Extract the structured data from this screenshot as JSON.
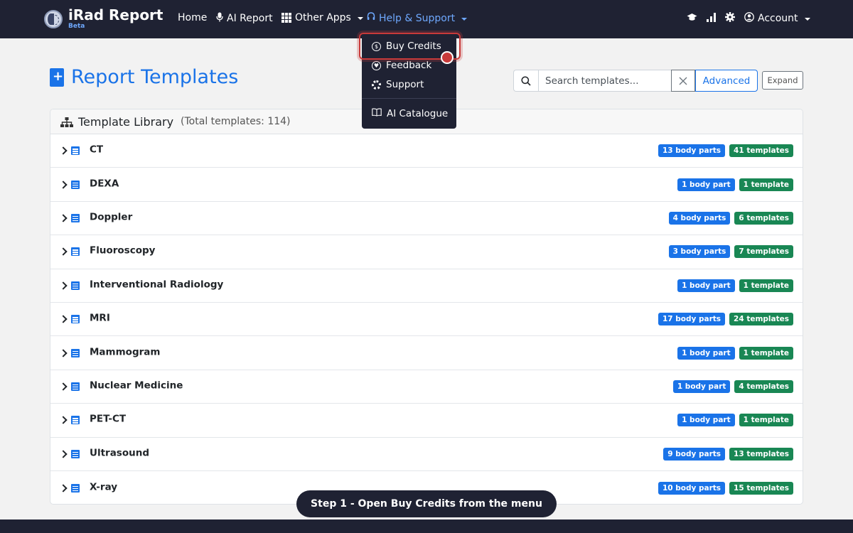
{
  "navbar": {
    "brand": "iRad Report",
    "brand_badge": "Beta",
    "items": [
      {
        "label": "Home",
        "icon": ""
      },
      {
        "label": "AI Report",
        "icon": "microphone-icon"
      },
      {
        "label": "Other Apps",
        "icon": "grid-icon"
      },
      {
        "label": "Help & Support",
        "icon": "headset-icon"
      }
    ],
    "right_icons": [
      "graduation-cap-icon",
      "signal-bars-icon",
      "gear-icon"
    ],
    "account_label": "Account"
  },
  "help_menu": {
    "items": [
      {
        "label": "Buy Credits",
        "icon": "dollar-circle-icon"
      },
      {
        "label": "Feedback",
        "icon": "chat-heart-icon"
      },
      {
        "label": "Support",
        "icon": "lifebuoy-icon"
      },
      {
        "label": "AI Catalogue",
        "icon": "book-icon"
      }
    ]
  },
  "page": {
    "title": "Report Templates",
    "search_placeholder": "Search templates...",
    "advanced_label": "Advanced",
    "expand_label": "Expand"
  },
  "library": {
    "title": "Template Library",
    "total": "(Total templates: 114)",
    "rows": [
      {
        "label": "CT",
        "parts": "13 body parts",
        "templates": "41 templates"
      },
      {
        "label": "DEXA",
        "parts": "1 body part",
        "templates": "1 template"
      },
      {
        "label": "Doppler",
        "parts": "4 body parts",
        "templates": "6 templates"
      },
      {
        "label": "Fluoroscopy",
        "parts": "3 body parts",
        "templates": "7 templates"
      },
      {
        "label": "Interventional Radiology",
        "parts": "1 body part",
        "templates": "1 template"
      },
      {
        "label": "MRI",
        "parts": "17 body parts",
        "templates": "24 templates"
      },
      {
        "label": "Mammogram",
        "parts": "1 body part",
        "templates": "1 template"
      },
      {
        "label": "Nuclear Medicine",
        "parts": "1 body part",
        "templates": "4 templates"
      },
      {
        "label": "PET-CT",
        "parts": "1 body part",
        "templates": "1 template"
      },
      {
        "label": "Ultrasound",
        "parts": "9 body parts",
        "templates": "13 templates"
      },
      {
        "label": "X-ray",
        "parts": "10 body parts",
        "templates": "15 templates"
      }
    ]
  },
  "tutorial": {
    "step_text": "Step 1 - Open Buy Credits from the menu"
  },
  "colors": {
    "navbar": "#1f2233",
    "accent": "#1a73e8",
    "badge_green": "#198754",
    "highlight": "#c83a3a"
  }
}
